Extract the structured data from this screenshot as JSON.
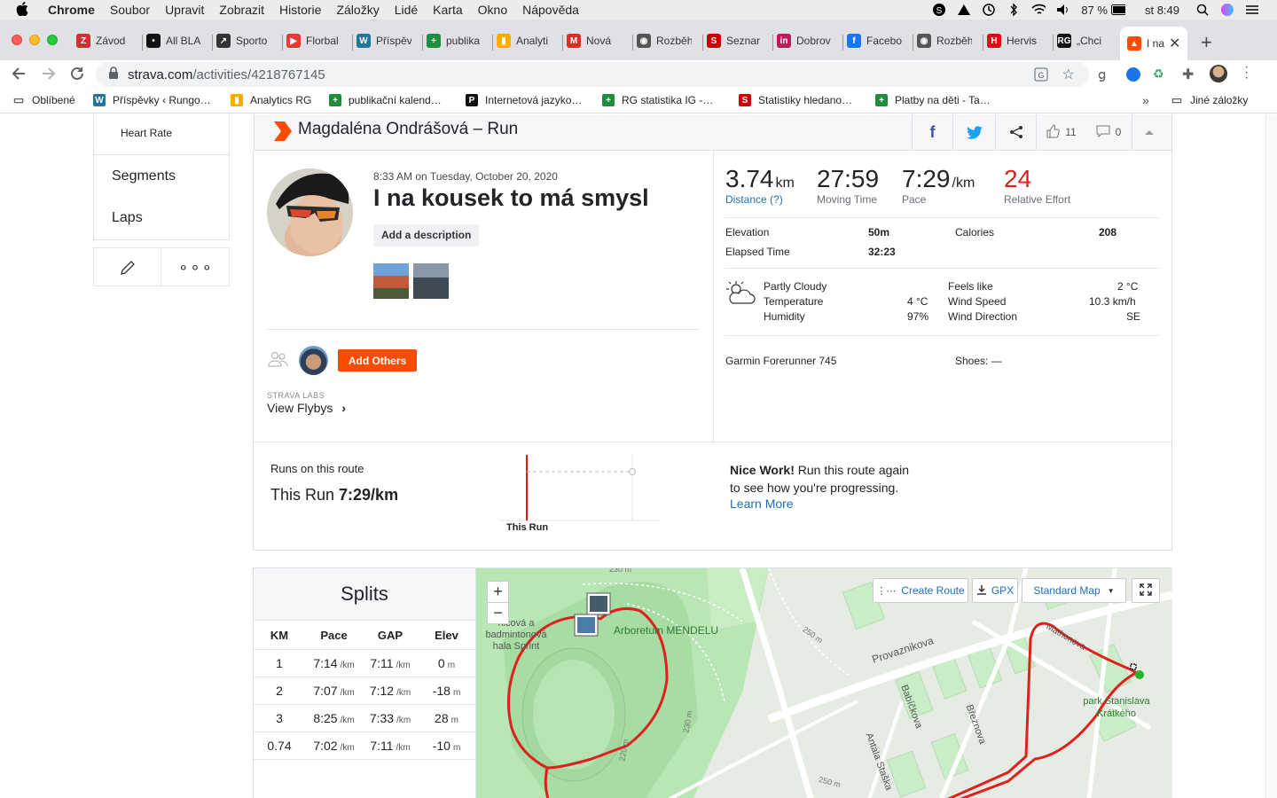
{
  "menubar": {
    "app": "Chrome",
    "items": [
      "Soubor",
      "Upravit",
      "Zobrazit",
      "Historie",
      "Záložky",
      "Lidé",
      "Karta",
      "Okno",
      "Nápověda"
    ],
    "battery": "87 %",
    "clock": "st 8:49"
  },
  "tabs": [
    {
      "title": "Závod",
      "color": "#d32f2f",
      "glyph": "Z"
    },
    {
      "title": "All BLA",
      "color": "#111111",
      "glyph": "•"
    },
    {
      "title": "Sporto",
      "color": "#333333",
      "glyph": "↗"
    },
    {
      "title": "Florbal",
      "color": "#e53935",
      "glyph": "▶"
    },
    {
      "title": "Příspěv",
      "color": "#21759b",
      "glyph": "W"
    },
    {
      "title": "publika",
      "color": "#1e8e3e",
      "glyph": "+"
    },
    {
      "title": "Analyti",
      "color": "#f9ab00",
      "glyph": "▮"
    },
    {
      "title": "Nová ",
      "color": "#d93025",
      "glyph": "M"
    },
    {
      "title": "Rozběh",
      "color": "#555555",
      "glyph": "◉"
    },
    {
      "title": "Seznar",
      "color": "#cc0000",
      "glyph": "S"
    },
    {
      "title": "Dobrov",
      "color": "#c2185b",
      "glyph": "in"
    },
    {
      "title": "Facebo",
      "color": "#1877f2",
      "glyph": "f"
    },
    {
      "title": "Rozběh",
      "color": "#555555",
      "glyph": "◉"
    },
    {
      "title": "Hervis",
      "color": "#e30613",
      "glyph": "H"
    },
    {
      "title": "„Chci ",
      "color": "#111111",
      "glyph": "RG"
    },
    {
      "title": "I na",
      "color": "#fc4c02",
      "glyph": "▲",
      "active": true
    }
  ],
  "address": {
    "domain": "strava.com",
    "path": "/activities/4218767145"
  },
  "bookmarks": {
    "items": [
      {
        "label": "Oblíbené",
        "color": "#666666",
        "glyph": "▭"
      },
      {
        "label": "Příspěvky ‹ Rungo…",
        "color": "#21759b",
        "glyph": "W"
      },
      {
        "label": "Analytics RG",
        "color": "#f9ab00",
        "glyph": "▮"
      },
      {
        "label": "publikační kalend…",
        "color": "#1e8e3e",
        "glyph": "+"
      },
      {
        "label": "Internetová jazyko…",
        "color": "#111111",
        "glyph": "P"
      },
      {
        "label": "RG statistika IG -…",
        "color": "#1e8e3e",
        "glyph": "+"
      },
      {
        "label": "Statistiky hledano…",
        "color": "#cc0000",
        "glyph": "S"
      },
      {
        "label": "Platby na děti - Ta…",
        "color": "#1e8e3e",
        "glyph": "+"
      }
    ],
    "more": "»",
    "other": "Jiné záložky"
  },
  "sidebar": {
    "heart_rate": "Heart Rate",
    "segments": "Segments",
    "laps": "Laps"
  },
  "header": {
    "title": "Magdaléna Ondrášová – Run",
    "kudos": "11",
    "comments": "0"
  },
  "activity": {
    "datetime": "8:33 AM on Tuesday, October 20, 2020",
    "name": "I na kousek to má smysl",
    "add_description": "Add a description",
    "add_others": "Add Others",
    "labs": "STRAVA LABS",
    "flybys": "View Flybys",
    "flybys_arrow": "›"
  },
  "stats": {
    "distance": {
      "value": "3.74",
      "unit": "km",
      "label": "Distance (?)"
    },
    "moving_time": {
      "value": "27:59",
      "label": "Moving Time"
    },
    "pace": {
      "value": "7:29",
      "unit": "/km",
      "label": "Pace"
    },
    "relative_effort": {
      "value": "24",
      "label": "Relative Effort"
    },
    "elevation_label": "Elevation",
    "elevation": "50m",
    "calories_label": "Calories",
    "calories": "208",
    "elapsed_label": "Elapsed Time",
    "elapsed": "32:23"
  },
  "weather": {
    "condition": "Partly Cloudy",
    "temperature_label": "Temperature",
    "temperature": "4 °C",
    "humidity_label": "Humidity",
    "humidity": "97%",
    "feels_like_label": "Feels like",
    "feels_like": "2 °C",
    "wind_speed_label": "Wind Speed",
    "wind_speed": "10.3 km/h",
    "wind_dir_label": "Wind Direction",
    "wind_dir": "SE"
  },
  "gear": {
    "device": "Garmin Forerunner 745",
    "shoes": "Shoes: —"
  },
  "route": {
    "title": "Runs on this route",
    "this_run_prefix": "This Run ",
    "this_run_pace": "7:29/km",
    "axis_label": "This Run",
    "nice_work": "Nice Work!",
    "nice_work_rest": " Run this route again to see how you're progressing.",
    "learn_more": "Learn More"
  },
  "splits": {
    "title": "Splits",
    "headers": [
      "KM",
      "Pace",
      "GAP",
      "Elev"
    ],
    "rows": [
      {
        "km": "1",
        "pace": "7:14",
        "gap": "7:11",
        "elev": "0"
      },
      {
        "km": "2",
        "pace": "7:07",
        "gap": "7:12",
        "elev": "-18"
      },
      {
        "km": "3",
        "pace": "8:25",
        "gap": "7:33",
        "elev": "28"
      },
      {
        "km": "0.74",
        "pace": "7:02",
        "gap": "7:11",
        "elev": "-10"
      }
    ],
    "pace_unit": "/km",
    "elev_unit": "m"
  },
  "map": {
    "create_route": "Create Route",
    "gpx": "GPX",
    "map_type": "Standard Map",
    "zoom_in": "+",
    "zoom_out": "−",
    "labels": {
      "hall": "nicová a badmintonová hala Sprint",
      "arboretum": "Arboretum MENDELU",
      "provaznikova": "Provaznikova",
      "babickova": "Babíčkova",
      "brenkova": "Březnova",
      "antala": "Antala Staška",
      "park": "park Stanislava Krátkého",
      "mathonova": "Mathonova",
      "c230": "230 m",
      "c250": "250 m",
      "c220": "220 m"
    }
  }
}
